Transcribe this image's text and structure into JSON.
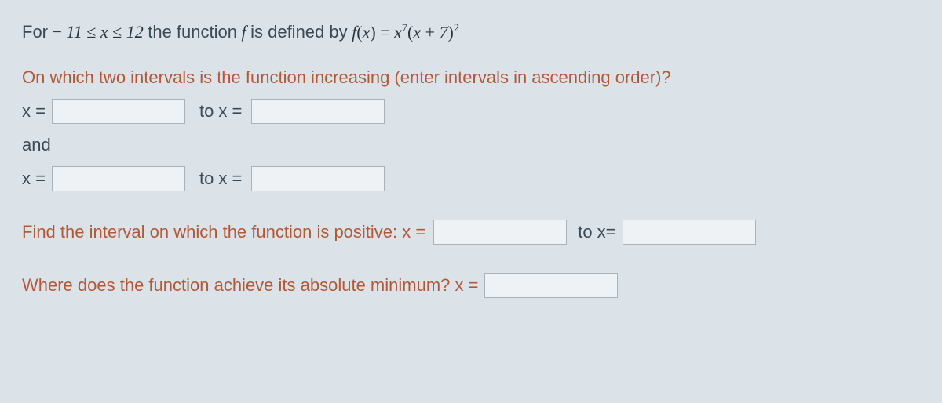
{
  "problem": {
    "prefix": "For ",
    "domain_math": "− 11 ≤ x ≤ 12",
    "mid": " the function ",
    "fn": "f",
    "mid2": " is defined by ",
    "equation_lhs": "f(x) = ",
    "equation_rhs_base1": "x",
    "equation_rhs_exp1": "7",
    "equation_rhs_base2": "(x + 7)",
    "equation_rhs_exp2": "2"
  },
  "q1": {
    "text": "On which two intervals is the function increasing (enter intervals in ascending order)?",
    "x_eq": "x =",
    "to_x_eq": "to x =",
    "and": "and"
  },
  "q2": {
    "text": "Find the interval on which the function is positive: x =",
    "to_x_eq": "to x="
  },
  "q3": {
    "text": "Where does the function achieve its absolute minimum? x ="
  }
}
